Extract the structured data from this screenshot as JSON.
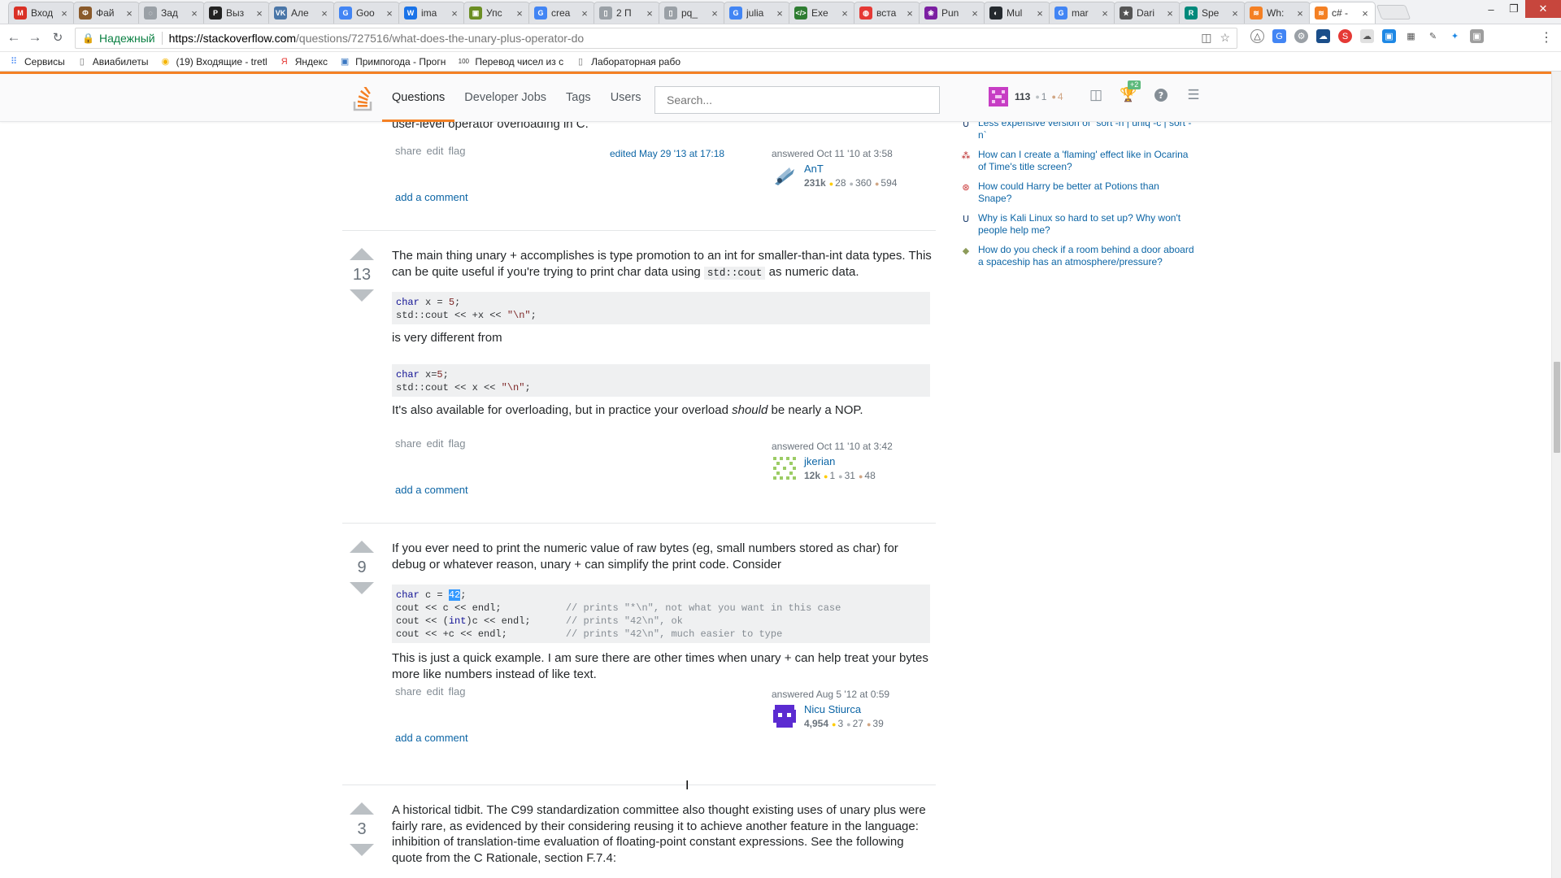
{
  "browser": {
    "tabs": [
      {
        "title": "Вход",
        "color": "#d93025",
        "glyph": "M",
        "active": false
      },
      {
        "title": "Фай",
        "color": "#8a5a2b",
        "glyph": "Ф",
        "active": false
      },
      {
        "title": "Зад",
        "color": "#9aa0a6",
        "glyph": "◌",
        "active": false
      },
      {
        "title": "Выз",
        "color": "#222222",
        "glyph": "P",
        "active": false
      },
      {
        "title": "Але",
        "color": "#4a76a8",
        "glyph": "VK",
        "active": false
      },
      {
        "title": "Goo",
        "color": "#4285f4",
        "glyph": "G",
        "active": false
      },
      {
        "title": "ima",
        "color": "#1a73e8",
        "glyph": "W",
        "active": false
      },
      {
        "title": "Упс",
        "color": "#6b8e23",
        "glyph": "▣",
        "active": false
      },
      {
        "title": "crea",
        "color": "#4285f4",
        "glyph": "G",
        "active": false
      },
      {
        "title": "2 П",
        "color": "#9aa0a6",
        "glyph": "▯",
        "active": false
      },
      {
        "title": "pq_",
        "color": "#9aa0a6",
        "glyph": "▯",
        "active": false
      },
      {
        "title": "julia",
        "color": "#4285f4",
        "glyph": "G",
        "active": false
      },
      {
        "title": "Exe",
        "color": "#2e7d32",
        "glyph": "</>",
        "active": false
      },
      {
        "title": "вста",
        "color": "#e53935",
        "glyph": "◍",
        "active": false
      },
      {
        "title": "Pun",
        "color": "#7b1fa2",
        "glyph": "❀",
        "active": false
      },
      {
        "title": "Mul",
        "color": "#24292e",
        "glyph": "◐",
        "active": false
      },
      {
        "title": "mar",
        "color": "#4285f4",
        "glyph": "G",
        "active": false
      },
      {
        "title": "Dari",
        "color": "#555555",
        "glyph": "★",
        "active": false
      },
      {
        "title": "Spe",
        "color": "#00897b",
        "glyph": "R",
        "active": false
      },
      {
        "title": "Wh:",
        "color": "#f48024",
        "glyph": "≋",
        "active": false
      },
      {
        "title": "c# -",
        "color": "#f48024",
        "glyph": "≋",
        "active": true
      }
    ],
    "secure_label": "Надежный",
    "url_host": "https://stackoverflow.com",
    "url_path": "/questions/727516/what-does-the-unary-plus-operator-do",
    "bookmarks": [
      {
        "label": "Сервисы",
        "icon": "grid",
        "color": "#4285f4"
      },
      {
        "label": "Авиабилеты",
        "icon": "page",
        "color": "#777777"
      },
      {
        "label": "(19) Входящие - tretl",
        "icon": "mail",
        "color": "#f4b400"
      },
      {
        "label": "Яндекс",
        "icon": "Я",
        "color": "#e53935"
      },
      {
        "label": "Примпогода - Прогн",
        "icon": "img",
        "color": "#3b78c2"
      },
      {
        "label": "Перевод чисел из с",
        "icon": "100",
        "color": "#333333"
      },
      {
        "label": "Лабораторная рабо",
        "icon": "page",
        "color": "#777777"
      }
    ]
  },
  "so": {
    "nav": [
      "Questions",
      "Developer Jobs",
      "Tags",
      "Users"
    ],
    "search_placeholder": "Search...",
    "reputation": "113",
    "silver": "1",
    "bronze": "4",
    "achievements_badge": "+2"
  },
  "prev_answer": {
    "cut_text": "user-level operator overloading in C.",
    "menu": [
      "share",
      "edit",
      "flag"
    ],
    "edited": "edited May 29 '13 at 17:18",
    "answered": "answered Oct 11 '10 at 3:58",
    "user": "AnT",
    "rep": "231k",
    "gold": "28",
    "silver": "360",
    "bronze": "594",
    "add_comment": "add a comment"
  },
  "answers": [
    {
      "votes": "13",
      "p1_a": "The main thing unary + accomplishes is type promotion to an int for smaller-than-int data types. This can be quite useful if you're trying to print char data using ",
      "p1_code": "std::cout",
      "p1_b": " as numeric data.",
      "p2": "is very different from",
      "p3_a": "It's also available for overloading, but in practice your overload ",
      "p3_em": "should",
      "p3_b": " be nearly a NOP.",
      "menu": [
        "share",
        "edit",
        "flag"
      ],
      "answered": "answered Oct 11 '10 at 3:42",
      "user": "jkerian",
      "rep": "12k",
      "gold": "1",
      "silver": "31",
      "bronze": "48",
      "add_comment": "add a comment"
    },
    {
      "votes": "9",
      "p1": "If you ever need to print the numeric value of raw bytes (eg, small numbers stored as char) for debug or whatever reason, unary + can simplify the print code. Consider",
      "p2": "This is just a quick example. I am sure there are other times when unary + can help treat your bytes more like numbers instead of like text.",
      "menu": [
        "share",
        "edit",
        "flag"
      ],
      "answered": "answered Aug 5 '12 at 0:59",
      "user": "Nicu Stiurca",
      "rep": "4,954",
      "gold": "3",
      "silver": "27",
      "bronze": "39",
      "add_comment": "add a comment"
    },
    {
      "votes": "3",
      "p1": "A historical tidbit. The C99 standardization committee also thought existing uses of unary plus were fairly rare, as evidenced by their considering reusing it to achieve another feature in the language: inhibition of translation-time evaluation of floating-point constant expressions. See the following quote from the C Rationale, section F.7.4:"
    }
  ],
  "hot_questions": [
    {
      "title": "Less expensive version of `sort -n | uniq -c | sort -n`",
      "icon": "unix"
    },
    {
      "title": "How can I create a 'flaming' effect like in Ocarina of Time's title screen?",
      "icon": "gamedev"
    },
    {
      "title": "How could Harry be better at Potions than Snape?",
      "icon": "scifi"
    },
    {
      "title": "Why is Kali Linux so hard to set up? Why won't people help me?",
      "icon": "unix"
    },
    {
      "title": "How do you check if a room behind a door aboard a spaceship has an atmosphere/pressure?",
      "icon": "worldbuilding"
    }
  ]
}
